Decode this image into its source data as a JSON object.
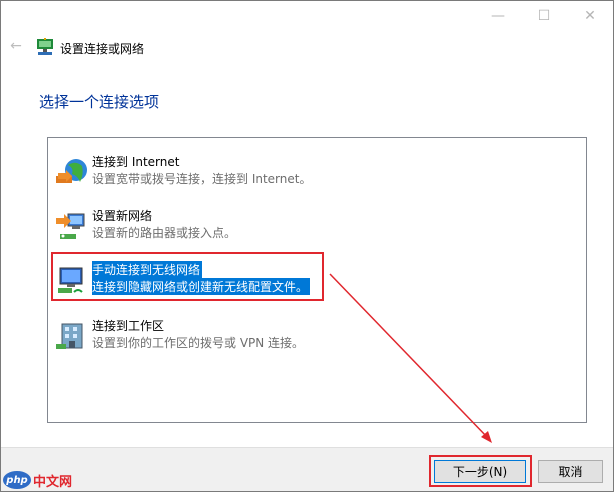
{
  "window": {
    "title": "设置连接或网络",
    "controls": {
      "minimize": "—",
      "maximize": "☐",
      "close": "✕"
    }
  },
  "heading": "选择一个连接选项",
  "options": [
    {
      "title": "连接到 Internet",
      "desc": "设置宽带或拨号连接，连接到 Internet。",
      "icon": "globe-network-icon"
    },
    {
      "title": "设置新网络",
      "desc": "设置新的路由器或接入点。",
      "icon": "new-network-computer-icon"
    },
    {
      "title": "手动连接到无线网络",
      "desc": "连接到隐藏网络或创建新无线配置文件。",
      "icon": "wireless-network-icon",
      "selected": true
    },
    {
      "title": "连接到工作区",
      "desc": "设置到你的工作区的拨号或 VPN 连接。",
      "icon": "workplace-building-icon"
    }
  ],
  "buttons": {
    "next": "下一步(N)",
    "cancel": "取消"
  },
  "watermark": {
    "logo": "php",
    "text": "中文网"
  },
  "colors": {
    "highlight": "#0078d7",
    "annotation": "#e0272e",
    "heading": "#003399"
  }
}
